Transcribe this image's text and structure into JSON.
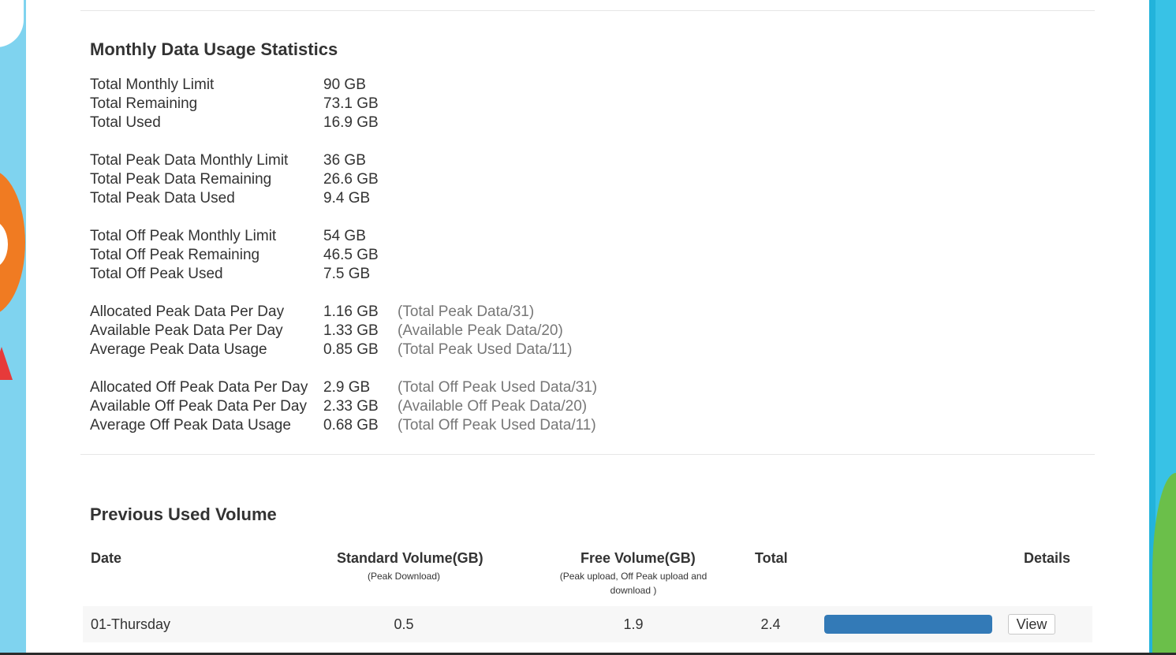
{
  "usage": {
    "title": "Monthly Data Usage Statistics",
    "groups": [
      {
        "rows": [
          {
            "label": "Total Monthly Limit",
            "value": "90 GB",
            "note": ""
          },
          {
            "label": "Total Remaining",
            "value": "73.1 GB",
            "note": ""
          },
          {
            "label": "Total Used",
            "value": "16.9 GB",
            "note": ""
          }
        ]
      },
      {
        "rows": [
          {
            "label": "Total Peak Data Monthly Limit",
            "value": "36 GB",
            "note": ""
          },
          {
            "label": "Total Peak Data Remaining",
            "value": "26.6 GB",
            "note": ""
          },
          {
            "label": "Total Peak Data Used",
            "value": "9.4 GB",
            "note": ""
          }
        ]
      },
      {
        "rows": [
          {
            "label": "Total Off Peak Monthly Limit",
            "value": "54 GB",
            "note": ""
          },
          {
            "label": "Total Off Peak Remaining",
            "value": "46.5 GB",
            "note": ""
          },
          {
            "label": "Total Off Peak Used",
            "value": "7.5 GB",
            "note": ""
          }
        ]
      },
      {
        "rows": [
          {
            "label": "Allocated Peak Data Per Day",
            "value": "1.16 GB",
            "note": "(Total Peak Data/31)"
          },
          {
            "label": "Available Peak Data Per Day",
            "value": "1.33 GB",
            "note": "(Available Peak Data/20)"
          },
          {
            "label": "Average Peak Data Usage",
            "value": "0.85 GB",
            "note": "(Total Peak Used Data/11)"
          }
        ]
      },
      {
        "rows": [
          {
            "label": "Allocated Off Peak Data Per Day",
            "value": "2.9 GB",
            "note": "(Total Off Peak Used Data/31)"
          },
          {
            "label": "Available Off Peak Data Per Day",
            "value": "2.33 GB",
            "note": "(Available Off Peak Data/20)"
          },
          {
            "label": "Average Off Peak Data Usage",
            "value": "0.68 GB",
            "note": "(Total Off Peak Used Data/11)"
          }
        ]
      }
    ]
  },
  "previous": {
    "title": "Previous Used Volume",
    "columns": {
      "date": "Date",
      "standard": "Standard Volume(GB)",
      "standard_sub": "(Peak Download)",
      "free": "Free Volume(GB)",
      "free_sub": "(Peak upload, Off Peak upload and download )",
      "total": "Total",
      "details": "Details"
    },
    "rows": [
      {
        "date": "01-Thursday",
        "standard": "0.5",
        "free": "1.9",
        "total": "2.4",
        "progress_percent": 100,
        "action": "View"
      }
    ]
  },
  "colors": {
    "progress_fill": "#337ab7",
    "row_background": "#f7f7f7",
    "note_text": "#777777"
  }
}
